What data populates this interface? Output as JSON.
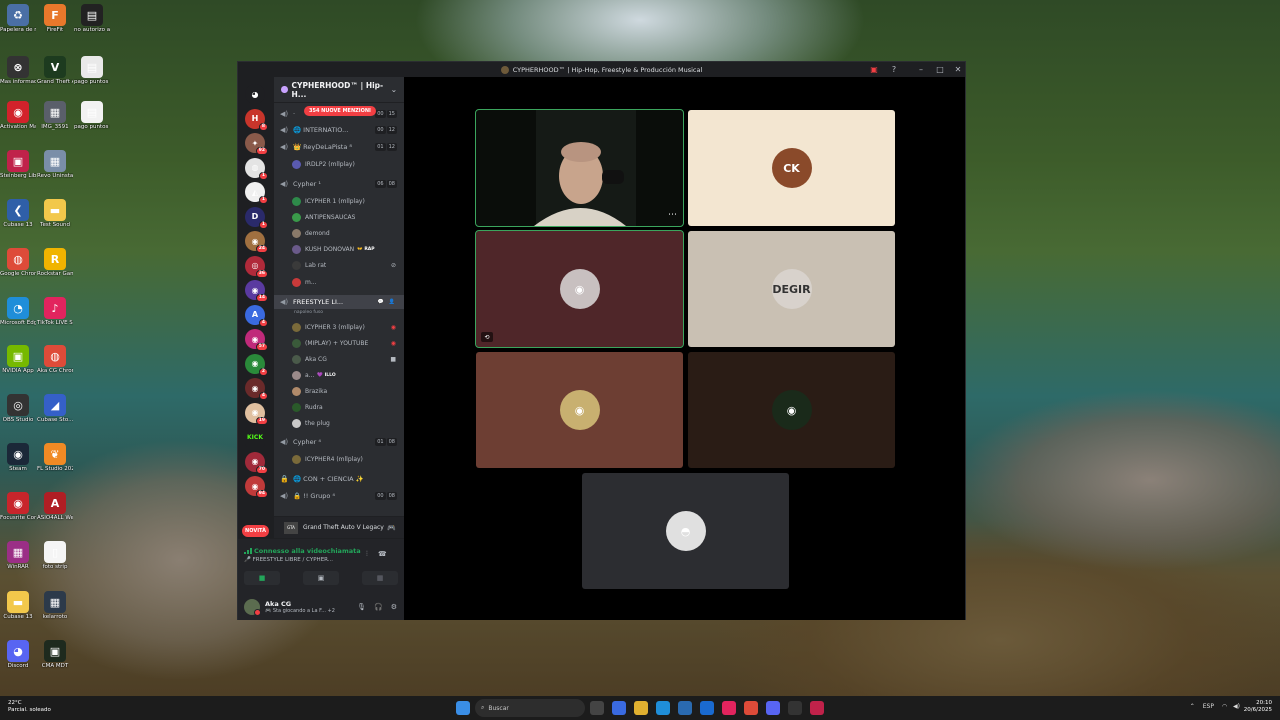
{
  "desktop": {
    "icons": [
      {
        "name": "Papelera de reciclaje",
        "glyph": "♻",
        "color": "#4a6fa5"
      },
      {
        "name": "FireFit",
        "glyph": "F",
        "color": "#e8782b"
      },
      {
        "name": "no autorizo ai.txt",
        "glyph": "▤",
        "color": "#222"
      },
      {
        "name": "Mas informacion",
        "glyph": "⊗",
        "color": "#333"
      },
      {
        "name": "Grand Theft Auto V Le...",
        "glyph": "V",
        "color": "#1d3b1f"
      },
      {
        "name": "pago puntos de orga",
        "glyph": "▤",
        "color": "#e9e9e9"
      },
      {
        "name": "Activation Manager",
        "glyph": "◉",
        "color": "#d2222b"
      },
      {
        "name": "IMG_3591",
        "glyph": "▦",
        "color": "#5a5f6a"
      },
      {
        "name": "pago puntos de orga",
        "glyph": "▤",
        "color": "#f2f2f2"
      },
      {
        "name": "Steinberg Library...",
        "glyph": "▣",
        "color": "#c0224a"
      },
      {
        "name": "Revo Uninstaller",
        "glyph": "▦",
        "color": "#7a8ea8"
      },
      {
        "name": "Cubase 13",
        "glyph": "❮",
        "color": "#2f5fa8"
      },
      {
        "name": "Test Sound",
        "glyph": "▬",
        "color": "#f2c84b"
      },
      {
        "name": "Google Chrome",
        "glyph": "◍",
        "color": "#de4b39"
      },
      {
        "name": "Rockstar Games...",
        "glyph": "R",
        "color": "#f0b400"
      },
      {
        "name": "Microsoft Edge",
        "glyph": "◔",
        "color": "#1f8ed9"
      },
      {
        "name": "TikTok LIVE Studio",
        "glyph": "♪",
        "color": "#e2245e"
      },
      {
        "name": "NVIDIA App",
        "glyph": "▣",
        "color": "#76b900"
      },
      {
        "name": "Aka CG Chrome",
        "glyph": "◍",
        "color": "#de4b39"
      },
      {
        "name": "OBS Studio",
        "glyph": "◎",
        "color": "#333"
      },
      {
        "name": "Cubase Sto...",
        "glyph": "◢",
        "color": "#3560c8"
      },
      {
        "name": "Steam",
        "glyph": "◉",
        "color": "#1b2838"
      },
      {
        "name": "FL Studio 2024",
        "glyph": "❦",
        "color": "#f08a24"
      },
      {
        "name": "Focusrite Control 2",
        "glyph": "◉",
        "color": "#c8252b"
      },
      {
        "name": "ASIO4ALL Web Site",
        "glyph": "A",
        "color": "#b01e24"
      },
      {
        "name": "WinRAR",
        "glyph": "▦",
        "color": "#9b2f86"
      },
      {
        "name": "foto strip",
        "glyph": "▯",
        "color": "#f5f5f5"
      },
      {
        "name": "Cubase 13",
        "glyph": "▬",
        "color": "#f2c84b"
      },
      {
        "name": "kelarroto",
        "glyph": "▦",
        "color": "#2c3a4a"
      },
      {
        "name": "Discord",
        "glyph": "◕",
        "color": "#5865f2"
      },
      {
        "name": "CMA MDT",
        "glyph": "▣",
        "color": "#1e2a1e"
      }
    ]
  },
  "window": {
    "title": "CYPHERHOOD™ | Hip-Hop, Freestyle & Producción Musical",
    "controls": {
      "inbox": "▣",
      "help": "?",
      "minimize": "–",
      "maximize": "□",
      "close": "✕"
    }
  },
  "servers": [
    {
      "label": "◕",
      "color": "#1e1f22",
      "badge": ""
    },
    {
      "label": "H",
      "color": "#c8352b",
      "badge": "8"
    },
    {
      "label": "✦",
      "color": "#8a5a4a",
      "badge": "92"
    },
    {
      "label": "◍",
      "color": "#e4e4e4",
      "badge": "1"
    },
    {
      "label": "◭",
      "color": "#f0f0f0",
      "badge": "1"
    },
    {
      "label": "D",
      "color": "#2a2a6a",
      "badge": "1"
    },
    {
      "label": "◉",
      "color": "#a07040",
      "badge": "24"
    },
    {
      "label": "◎",
      "color": "#b02a3a",
      "badge": "36"
    },
    {
      "label": "◉",
      "color": "#5a3aa0",
      "badge": "14"
    },
    {
      "label": "A",
      "color": "#3a6ae0",
      "badge": "4"
    },
    {
      "label": "◉",
      "color": "#c02a7a",
      "badge": "57"
    },
    {
      "label": "◉",
      "color": "#2a8a3a",
      "badge": "2"
    },
    {
      "label": "◉",
      "color": "#6a2a2a",
      "badge": "4"
    },
    {
      "label": "◉",
      "color": "#e0c0a0",
      "badge": "19"
    },
    {
      "label": "KICK",
      "color": "#1e1f22",
      "badge": ""
    },
    {
      "label": "◉",
      "color": "#a02a3a",
      "badge": "70"
    },
    {
      "label": "◉",
      "color": "#c03a3a",
      "badge": "94"
    }
  ],
  "servers_new_label": "NOVITÀ",
  "guild": {
    "name": "CYPHERHOOD™ | Hip-H...",
    "mentions": "354 NUOVE MENZIONI",
    "channels": [
      {
        "name": "·",
        "counts": [
          "00",
          "15"
        ]
      },
      {
        "name": "🌐 INTERNATIO...",
        "counts": [
          "00",
          "12"
        ]
      },
      {
        "name": "👑 ReyDeLaPista ⁸",
        "counts": [
          "01",
          "12"
        ]
      }
    ],
    "reydelapista_user": "IRDLP2 (mllplay)",
    "cypher1": {
      "name": "Cypher ¹",
      "counts": [
        "06",
        "08"
      ]
    },
    "cypher1_users": [
      {
        "name": "ICYPHER 1 (mllplay)",
        "tag": "",
        "color": "#2e8a4a"
      },
      {
        "name": "ANTIPENSAUCAS",
        "tag": "",
        "color": "#3a9a4a"
      },
      {
        "name": "demond",
        "tag": "",
        "color": "#8a7a6a"
      },
      {
        "name": "KUSH DONOVAN",
        "tag": "👐 RAP",
        "color": "#6a5a8a"
      },
      {
        "name": "Lab rat",
        "tag": "",
        "color": "#3a3a3a"
      },
      {
        "name": "m...",
        "tag": "",
        "color": "#c83a3a"
      }
    ],
    "freestyle": {
      "name": "FREESTYLE LI...",
      "sub": "napoleo fuso"
    },
    "freestyle_users": [
      {
        "name": "ICYPHER 3 (mllplay)",
        "tag": "",
        "color": "#7a6a3a"
      },
      {
        "name": "(MIPLAY) + YOUTUBE",
        "tag": "",
        "color": "#3a5a3a"
      },
      {
        "name": "Aka CG",
        "tag": "",
        "color": "#4a5a4a"
      },
      {
        "name": "a...",
        "tag": "💜 ILLO",
        "color": "#9a8a8a"
      },
      {
        "name": "Brazika",
        "tag": "",
        "color": "#b08a6a"
      },
      {
        "name": "Rudra",
        "tag": "",
        "color": "#2a5a2a"
      },
      {
        "name": "the plug",
        "tag": "",
        "color": "#c8c8c8"
      }
    ],
    "cypher4": {
      "name": "Cypher ⁴",
      "counts": [
        "01",
        "08"
      ]
    },
    "cypher4_user": "ICYPHER4 (mllplay)",
    "locked_channels": [
      {
        "name": "🌐 CON + CIENCIA ✨"
      },
      {
        "name": "🔒 !! Grupo ⁴",
        "counts": [
          "00",
          "08"
        ]
      }
    ]
  },
  "activity": {
    "game": "Grand Theft Auto V Legacy",
    "game_icon": "GTA"
  },
  "voice": {
    "status": "Connesso alla videochiamata",
    "channel": "🎤 FREESTYLE LIBRE / CYPHER..."
  },
  "user": {
    "name": "Aka CG",
    "status": "🎮 Sta giocando a La F... +2"
  },
  "tiles": [
    {
      "kind": "video",
      "label": "",
      "bg": "#0c0f0c",
      "avatar_bg": "#000"
    },
    {
      "kind": "avatar",
      "label": "CK",
      "bg": "#f3e6d1",
      "avatar_bg": "#8a4a2a"
    },
    {
      "kind": "avatar",
      "label": "◉",
      "bg": "#4f2629",
      "avatar_bg": "#c8c0c0"
    },
    {
      "kind": "avatar",
      "label": "DEGIR",
      "bg": "#c9c0b3",
      "avatar_bg": "#d8d2cc"
    },
    {
      "kind": "avatar",
      "label": "◉",
      "bg": "#6d3e33",
      "avatar_bg": "#c8b070"
    },
    {
      "kind": "avatar",
      "label": "◉",
      "bg": "#2a1c15",
      "avatar_bg": "#1a2a1a"
    },
    {
      "kind": "avatar",
      "label": "◓",
      "bg": "#2c2d31",
      "avatar_bg": "#e0e0e0"
    }
  ],
  "taskbar": {
    "weather_temp": "22°C",
    "weather_desc": "Parcial. soleado",
    "search_placeholder": "Buscar",
    "lang": "ESP",
    "time": "20:10",
    "date": "20/6/2025"
  }
}
